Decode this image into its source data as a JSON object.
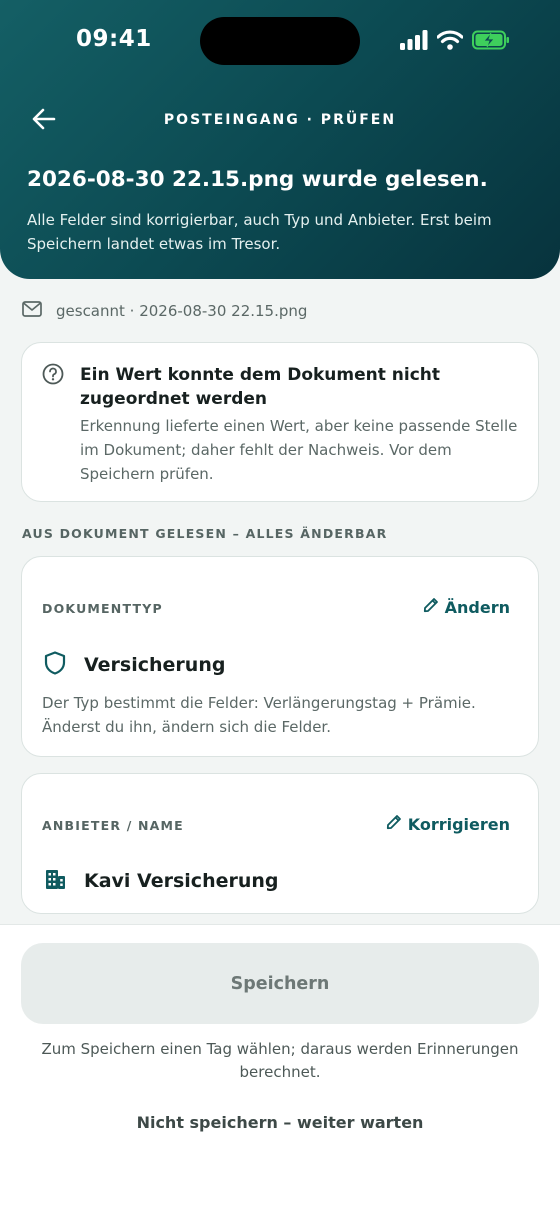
{
  "status_bar": {
    "time": "09:41",
    "icons": [
      "signal-icon",
      "wifi-icon",
      "battery-charging-icon"
    ],
    "battery_color": "#3ecf5c"
  },
  "header": {
    "nav_title": "POSTEINGANG · PRÜFEN",
    "title": "2026-08-30 22.15.png wurde gelesen.",
    "subtitle": "Alle Felder sind korrigierbar, auch Typ und Anbieter. Erst beim Speichern landet etwas im Tresor.",
    "gradient_colors": [
      "#145f65",
      "#07333d"
    ]
  },
  "source": {
    "icon": "mail-icon",
    "text": "gescannt · 2026-08-30 22.15.png"
  },
  "warning": {
    "icon": "question-circle-icon",
    "title": "Ein Wert konnte dem Dokument nicht zugeordnet werden",
    "body": "Erkennung lieferte einen Wert, aber keine passende Stelle im Dokument; daher fehlt der Nachweis. Vor dem Speichern prüfen."
  },
  "section_label": "AUS DOKUMENT GELESEN – ALLES ÄNDERBAR",
  "document_type": {
    "label": "DOKUMENTTYP",
    "edit_label": "Ändern",
    "icon": "shield-icon",
    "value": "Versicherung",
    "note": "Der Typ bestimmt die Felder: Verlängerungstag + Prämie. Änderst du ihn, ändern sich die Felder."
  },
  "provider": {
    "label": "ANBIETER / NAME",
    "edit_label": "Korrigieren",
    "icon": "building-icon",
    "value": "Kavi Versicherung"
  },
  "footer": {
    "save_label": "Speichern",
    "save_hint": "Zum Speichern einen Tag wählen; daraus werden Erinnerungen berechnet.",
    "skip_label": "Nicht speichern – weiter warten"
  },
  "accent_color": "#0f5b60"
}
